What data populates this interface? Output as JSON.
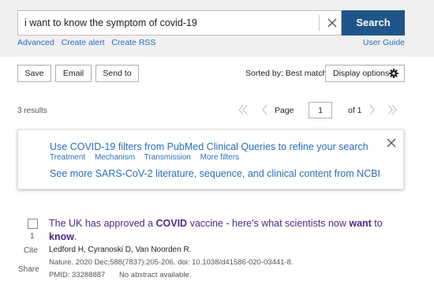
{
  "search": {
    "query": "i want to know the symptom of covid-19",
    "button_label": "Search",
    "links": [
      "Advanced",
      "Create alert",
      "Create RSS"
    ],
    "user_guide": "User Guide"
  },
  "toolbar": {
    "save": "Save",
    "email": "Email",
    "send_to": "Send to",
    "sorted_by": "Sorted by: Best match",
    "display_options": "Display options"
  },
  "results": {
    "count_text": "3 results",
    "page_label": "Page",
    "page_value": "1",
    "of_label": "of 1"
  },
  "banner": {
    "main_link": "Use COVID-19 filters from PubMed Clinical Queries to refine your search",
    "filters": [
      "Treatment",
      "Mechanism",
      "Transmission",
      "More filters"
    ],
    "more_link": "See more SARS-CoV-2 literature, sequence, and clinical content from NCBI"
  },
  "result_item": {
    "number": "1",
    "cite": "Cite",
    "share": "Share",
    "title_parts": [
      "The UK has approved a ",
      "COVID",
      " vaccine - here's what scientists now ",
      "want",
      " to ",
      "know",
      "."
    ],
    "authors": "Ledford H, Cyranoski D, Van Noorden R.",
    "citation": "Nature. 2020 Dec;588(7837):205-206. doi: 10.1038/d41586-020-03441-8.",
    "pmid": "PMID: 33288887",
    "no_abstract": "No abstract available."
  },
  "colors": {
    "accent": "#20558a",
    "link": "#2a6ebb",
    "visited_title": "#4b2a85"
  }
}
